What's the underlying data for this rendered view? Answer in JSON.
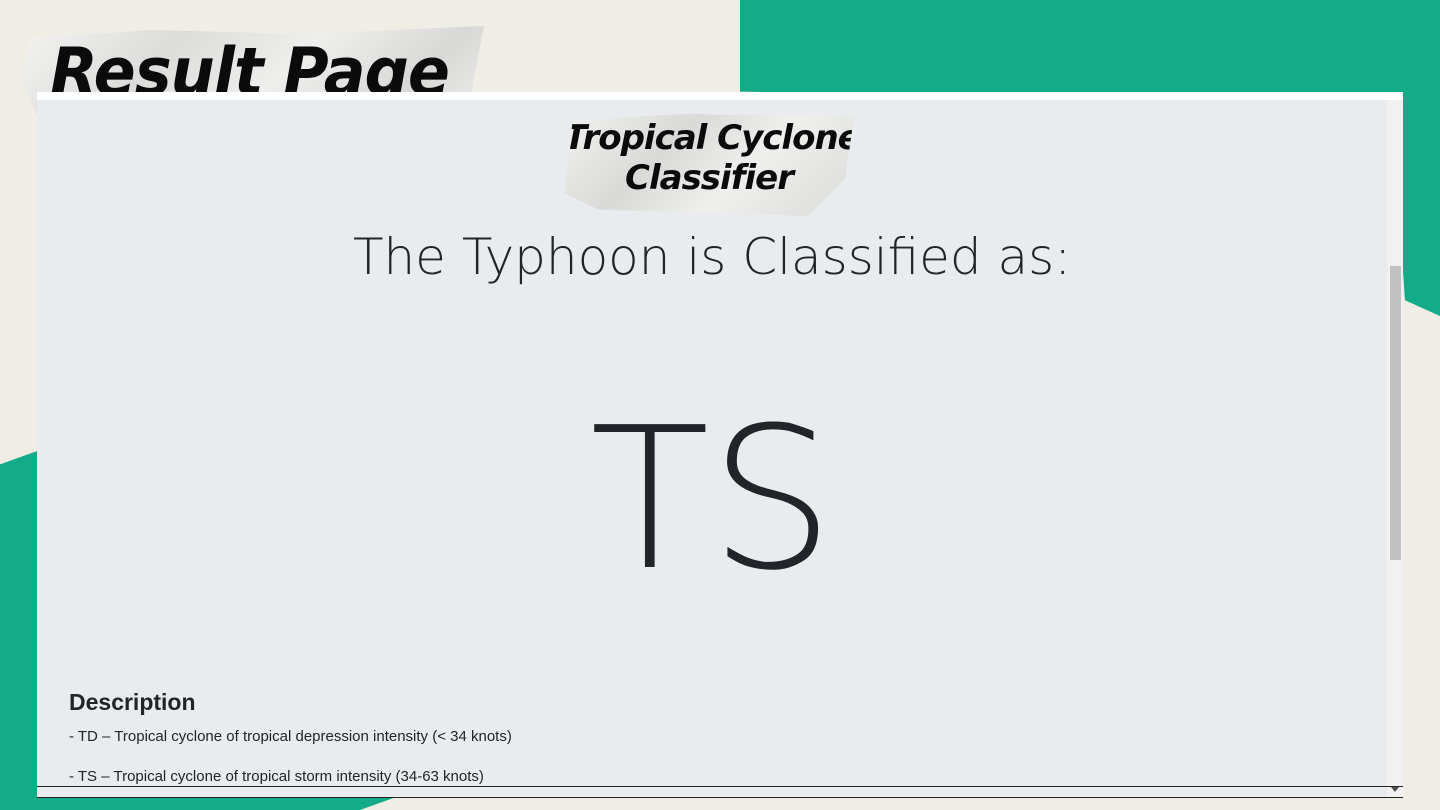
{
  "slide": {
    "title": "Result Page",
    "colors": {
      "accent": "#13ab88",
      "background": "#efede6"
    }
  },
  "app": {
    "logo_line1": "Tropical Cyclone",
    "logo_line2": "Classifier",
    "result_heading": "The Typhoon is Classified as:",
    "result_value": "TS",
    "description": {
      "title": "Description",
      "items": [
        "- TD – Tropical cyclone of tropical depression intensity (< 34 knots)",
        "- TS – Tropical cyclone of tropical storm intensity (34-63 knots)"
      ]
    },
    "colors": {
      "page_background": "#e9ecef",
      "text": "#212529",
      "scrollbar_thumb": "#c1c1c1"
    }
  }
}
